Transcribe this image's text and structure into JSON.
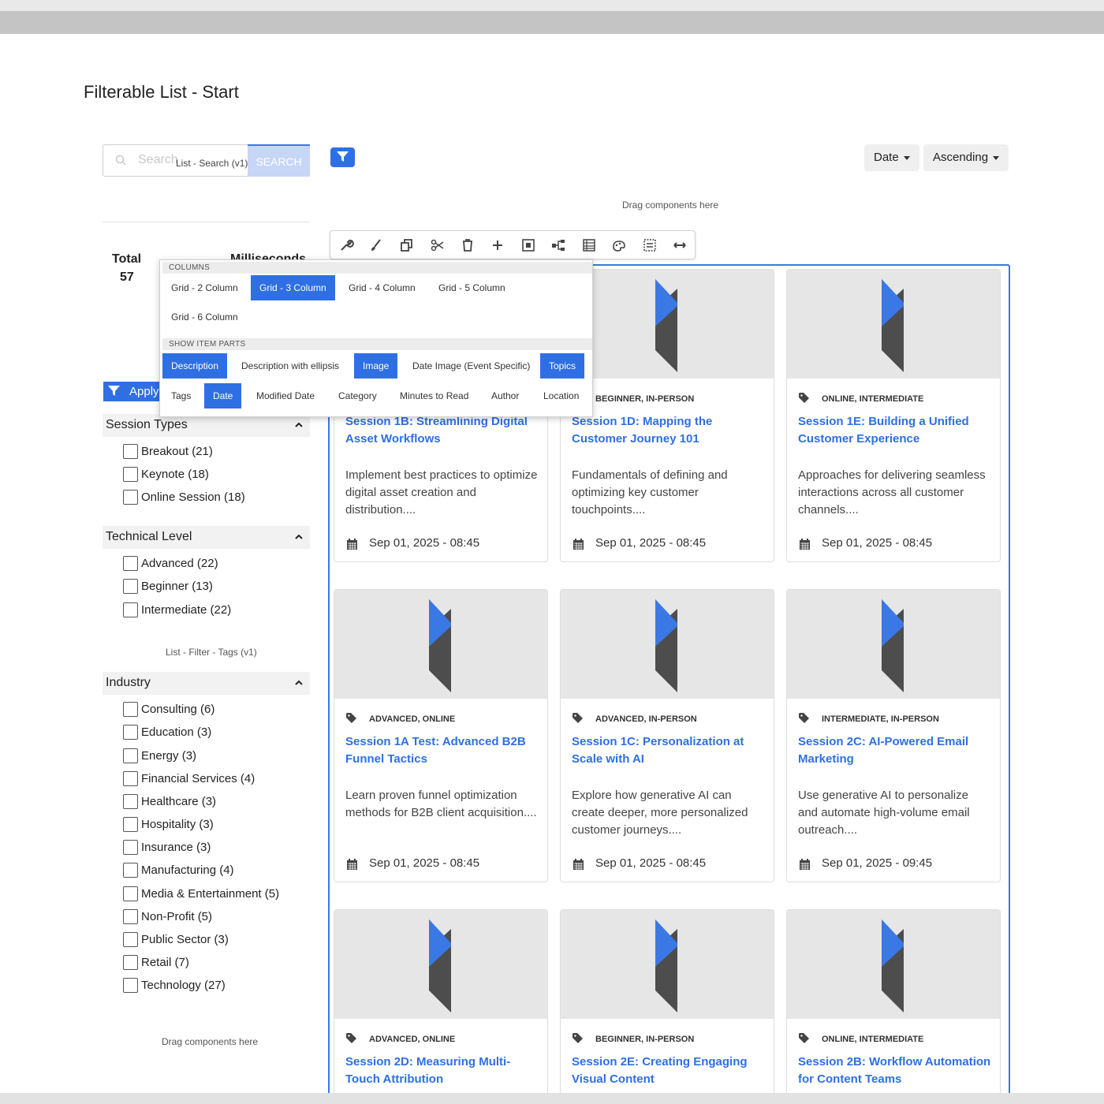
{
  "page": {
    "title": "Filterable List - Start"
  },
  "search": {
    "placeholder": "Search",
    "component_label": "List - Search (v1)",
    "button": "SEARCH"
  },
  "sort": {
    "field": "Date",
    "order": "Ascending"
  },
  "drag_hint": "Drag components here",
  "stats": {
    "total_label": "Total",
    "total_value": "57",
    "ms_label": "Milliseconds"
  },
  "apply_label": "Apply",
  "popup": {
    "columns_heading": "COLUMNS",
    "columns": [
      {
        "label": "Grid - 2 Column",
        "selected": false
      },
      {
        "label": "Grid - 3 Column",
        "selected": true
      },
      {
        "label": "Grid - 4 Column",
        "selected": false
      },
      {
        "label": "Grid - 5 Column",
        "selected": false
      },
      {
        "label": "Grid - 6 Column",
        "selected": false
      }
    ],
    "parts_heading": "SHOW ITEM PARTS",
    "parts": [
      {
        "label": "Description",
        "selected": true
      },
      {
        "label": "Description with ellipsis",
        "selected": false
      },
      {
        "label": "Image",
        "selected": true
      },
      {
        "label": "Date Image (Event Specific)",
        "selected": false
      },
      {
        "label": "Topics",
        "selected": true
      },
      {
        "label": "Tags",
        "selected": false
      },
      {
        "label": "Date",
        "selected": true
      },
      {
        "label": "Modified Date",
        "selected": false
      },
      {
        "label": "Category",
        "selected": false
      },
      {
        "label": "Minutes to Read",
        "selected": false
      },
      {
        "label": "Author",
        "selected": false
      },
      {
        "label": "Location",
        "selected": false
      }
    ]
  },
  "toolbar": [
    "wrench-icon",
    "brush-icon",
    "copy-icon",
    "scissors-icon",
    "trash-icon",
    "plus-icon",
    "frame-icon",
    "hierarchy-icon",
    "list-icon",
    "palette-icon",
    "component-icon",
    "resize-icon"
  ],
  "filters": {
    "session_types": {
      "title": "Session Types",
      "items": [
        "Breakout (21)",
        "Keynote (18)",
        "Online Session (18)"
      ]
    },
    "technical_level": {
      "title": "Technical Level",
      "items": [
        "Advanced (22)",
        "Beginner (13)",
        "Intermediate (22)"
      ]
    },
    "tags_component_label": "List - Filter - Tags (v1)",
    "industry": {
      "title": "Industry",
      "items": [
        "Consulting (6)",
        "Education (3)",
        "Energy (3)",
        "Financial Services (4)",
        "Healthcare (3)",
        "Hospitality (3)",
        "Insurance (3)",
        "Manufacturing (4)",
        "Media & Entertainment (5)",
        "Non-Profit (5)",
        "Public Sector (3)",
        "Retail (7)",
        "Technology (27)"
      ]
    }
  },
  "cards": [
    {
      "tags": "",
      "title": "Session 1B: Streamlining Digital Asset Workflows",
      "desc": "Implement best practices to optimize digital asset creation and distribution....",
      "date": "Sep 01, 2025 - 08:45"
    },
    {
      "tags": "BEGINNER, IN-PERSON",
      "title": "Session 1D: Mapping the Customer Journey 101",
      "desc": "Fundamentals of defining and optimizing key customer touchpoints....",
      "date": "Sep 01, 2025 - 08:45"
    },
    {
      "tags": "ONLINE, INTERMEDIATE",
      "title": "Session 1E: Building a Unified Customer Experience",
      "desc": "Approaches for delivering seamless interactions across all customer channels....",
      "date": "Sep 01, 2025 - 08:45"
    },
    {
      "tags": "ADVANCED, ONLINE",
      "title": "Session 1A Test: Advanced B2B Funnel Tactics",
      "desc": "Learn proven funnel optimization methods for B2B client acquisition....",
      "date": "Sep 01, 2025 - 08:45"
    },
    {
      "tags": "ADVANCED, IN-PERSON",
      "title": "Session 1C: Personalization at Scale with AI",
      "desc": "Explore how generative AI can create deeper, more personalized customer journeys....",
      "date": "Sep 01, 2025 - 08:45"
    },
    {
      "tags": "INTERMEDIATE, IN-PERSON",
      "title": "Session 2C: AI-Powered Email Marketing",
      "desc": "Use generative AI to personalize and automate high-volume email outreach....",
      "date": "Sep 01, 2025 - 09:45"
    },
    {
      "tags": "ADVANCED, ONLINE",
      "title": "Session 2D: Measuring Multi-Touch Attribution",
      "desc": "",
      "date": ""
    },
    {
      "tags": "BEGINNER, IN-PERSON",
      "title": "Session 2E: Creating Engaging Visual Content",
      "desc": "",
      "date": ""
    },
    {
      "tags": "ONLINE, INTERMEDIATE",
      "title": "Session 2B: Workflow Automation for Content Teams",
      "desc": "",
      "date": ""
    }
  ],
  "colors": {
    "accent": "#2f6fe4",
    "logo_blue": "#3a78e6",
    "logo_dark": "#4d4d4d"
  }
}
